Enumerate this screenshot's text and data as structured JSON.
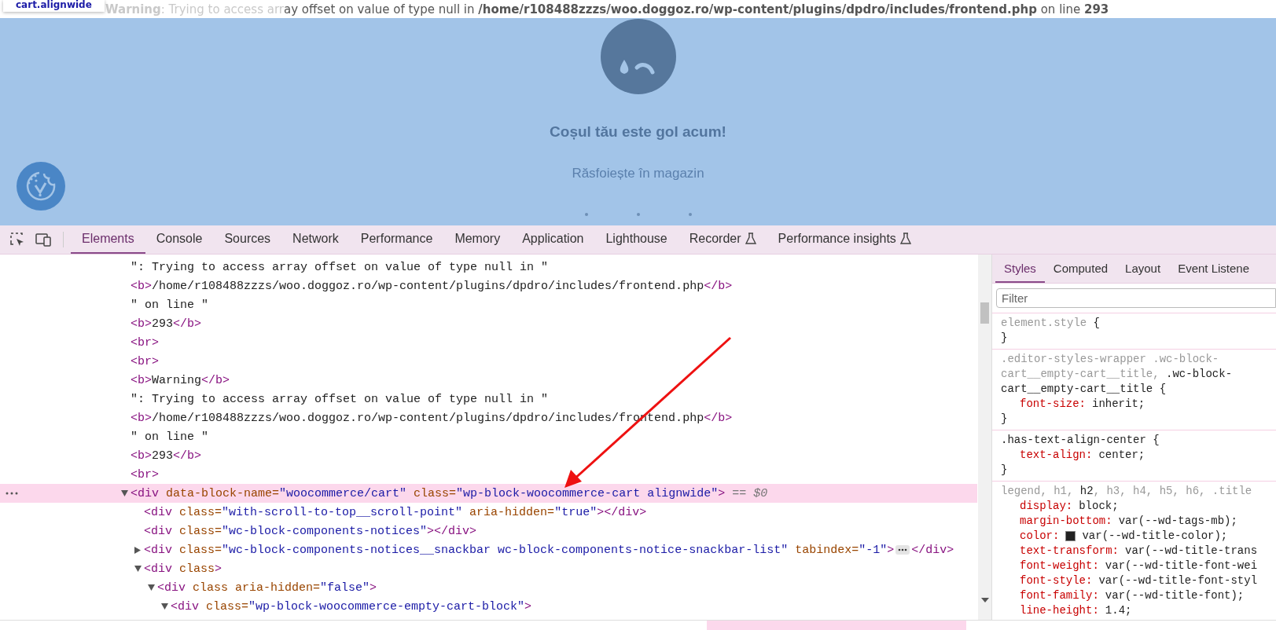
{
  "tooltip": {
    "text": "cart.alignwide"
  },
  "warning": {
    "faded_text": "**Warning**: Trying to access arr",
    "text": "ay offset on value of type null in **/home/r108488zzzs/woo.doggoz.ro/wp-content/plugins/dpdro/includes/frontend.php** on line **293**"
  },
  "preview": {
    "title": "Coșul tău este gol acum!",
    "link": "Răsfoiește în magazin"
  },
  "devtools_tabs": [
    {
      "label": "Elements",
      "selected": true,
      "experimental": false
    },
    {
      "label": "Console",
      "selected": false,
      "experimental": false
    },
    {
      "label": "Sources",
      "selected": false,
      "experimental": false
    },
    {
      "label": "Network",
      "selected": false,
      "experimental": false
    },
    {
      "label": "Performance",
      "selected": false,
      "experimental": false
    },
    {
      "label": "Memory",
      "selected": false,
      "experimental": false
    },
    {
      "label": "Application",
      "selected": false,
      "experimental": false
    },
    {
      "label": "Lighthouse",
      "selected": false,
      "experimental": false
    },
    {
      "label": "Recorder",
      "selected": false,
      "experimental": true
    },
    {
      "label": "Performance insights",
      "selected": false,
      "experimental": true
    }
  ],
  "dom_tree": [
    {
      "selected": false,
      "tokens": [
        {
          "kind": "text",
          "text": "\": Trying to access array offset on value of type null in \""
        }
      ]
    },
    {
      "selected": false,
      "tokens": [
        {
          "kind": "tag",
          "text": "<b>"
        },
        {
          "kind": "text",
          "text": "/home/r108488zzzs/woo.doggoz.ro/wp-content/plugins/dpdro/includes/frontend.php"
        },
        {
          "kind": "tag",
          "text": "</b>"
        }
      ]
    },
    {
      "selected": false,
      "tokens": [
        {
          "kind": "text",
          "text": "\" on line \""
        }
      ]
    },
    {
      "selected": false,
      "tokens": [
        {
          "kind": "tag",
          "text": "<b>"
        },
        {
          "kind": "text",
          "text": "293"
        },
        {
          "kind": "tag",
          "text": "</b>"
        }
      ]
    },
    {
      "selected": false,
      "tokens": [
        {
          "kind": "tag",
          "text": "<br>"
        }
      ]
    },
    {
      "selected": false,
      "tokens": [
        {
          "kind": "tag",
          "text": "<br>"
        }
      ]
    },
    {
      "selected": false,
      "tokens": [
        {
          "kind": "tag",
          "text": "<b>"
        },
        {
          "kind": "text",
          "text": "Warning"
        },
        {
          "kind": "tag",
          "text": "</b>"
        }
      ]
    },
    {
      "selected": false,
      "tokens": [
        {
          "kind": "text",
          "text": "\": Trying to access array offset on value of type null in \""
        }
      ]
    },
    {
      "selected": false,
      "tokens": [
        {
          "kind": "tag",
          "text": "<b>"
        },
        {
          "kind": "text",
          "text": "/home/r108488zzzs/woo.doggoz.ro/wp-content/plugins/dpdro/includes/frontend.php"
        },
        {
          "kind": "tag",
          "text": "</b>"
        }
      ]
    },
    {
      "selected": false,
      "tokens": [
        {
          "kind": "text",
          "text": "\" on line \""
        }
      ]
    },
    {
      "selected": false,
      "tokens": [
        {
          "kind": "tag",
          "text": "<b>"
        },
        {
          "kind": "text",
          "text": "293"
        },
        {
          "kind": "tag",
          "text": "</b>"
        }
      ]
    },
    {
      "selected": false,
      "tokens": [
        {
          "kind": "tag",
          "text": "<br>"
        }
      ]
    },
    {
      "selected": true,
      "expanded": true,
      "tokens": [
        {
          "kind": "tag",
          "text": "<div"
        },
        {
          "kind": "attr",
          "text": " data-block-name="
        },
        {
          "kind": "value",
          "text": "\"woocommerce/cart\""
        },
        {
          "kind": "attr",
          "text": " class="
        },
        {
          "kind": "value",
          "text": "\"wp-block-woocommerce-cart alignwide\""
        },
        {
          "kind": "tag",
          "text": ">"
        },
        {
          "kind": "ref",
          "text": " == $0"
        }
      ],
      "children": [
        {
          "selected": false,
          "tokens": [
            {
              "kind": "tag",
              "text": "<div"
            },
            {
              "kind": "attr",
              "text": " class="
            },
            {
              "kind": "value",
              "text": "\"with-scroll-to-top__scroll-point\""
            },
            {
              "kind": "attr",
              "text": " aria-hidden="
            },
            {
              "kind": "value",
              "text": "\"true\""
            },
            {
              "kind": "tag",
              "text": "></div>"
            }
          ]
        },
        {
          "selected": false,
          "tokens": [
            {
              "kind": "tag",
              "text": "<div"
            },
            {
              "kind": "attr",
              "text": " class="
            },
            {
              "kind": "value",
              "text": "\"wc-block-components-notices\""
            },
            {
              "kind": "tag",
              "text": "></div>"
            }
          ]
        },
        {
          "selected": false,
          "expanded": false,
          "tokens": [
            {
              "kind": "tag",
              "text": "<div"
            },
            {
              "kind": "attr",
              "text": " class="
            },
            {
              "kind": "value",
              "text": "\"wc-block-components-notices__snackbar wc-block-components-notice-snackbar-list\""
            },
            {
              "kind": "attr",
              "text": " tabindex="
            },
            {
              "kind": "value",
              "text": "\"-1\""
            },
            {
              "kind": "tag",
              "text": ">"
            }
          ],
          "closing": [
            {
              "kind": "tag",
              "text": "</div>"
            }
          ]
        },
        {
          "selected": false,
          "expanded": true,
          "tokens": [
            {
              "kind": "tag",
              "text": "<div"
            },
            {
              "kind": "attr",
              "text": " class"
            },
            {
              "kind": "tag",
              "text": ">"
            }
          ],
          "children": [
            {
              "selected": false,
              "expanded": true,
              "tokens": [
                {
                  "kind": "tag",
                  "text": "<div"
                },
                {
                  "kind": "attr",
                  "text": " class aria-hidden="
                },
                {
                  "kind": "value",
                  "text": "\"false\""
                },
                {
                  "kind": "tag",
                  "text": ">"
                }
              ],
              "children": [
                {
                  "selected": false,
                  "expanded": true,
                  "tokens": [
                    {
                      "kind": "tag",
                      "text": "<div"
                    },
                    {
                      "kind": "attr",
                      "text": " class="
                    },
                    {
                      "kind": "value",
                      "text": "\"wp-block-woocommerce-empty-cart-block\""
                    },
                    {
                      "kind": "tag",
                      "text": ">"
                    }
                  ]
                }
              ]
            }
          ]
        }
      ]
    }
  ],
  "styles_tabs": [
    {
      "label": "Styles",
      "selected": true
    },
    {
      "label": "Computed",
      "selected": false
    },
    {
      "label": "Layout",
      "selected": false
    },
    {
      "label": "Event Listene",
      "selected": false
    }
  ],
  "filter": {
    "placeholder": "Filter"
  },
  "rules": [
    {
      "selector": [
        [
          {
            "text": "element.style",
            "matched": false
          },
          {
            "text": " {",
            "matched": true
          }
        ]
      ],
      "close": "}"
    },
    {
      "selector": [
        [
          {
            "text": ".editor-styles-wrapper .wc-block-",
            "matched": false
          }
        ],
        [
          {
            "text": "cart__empty-cart__title,",
            "matched": false
          },
          {
            "text": " .wc-block-",
            "matched": true
          }
        ],
        [
          {
            "text": "cart__empty-cart__title {",
            "matched": true
          }
        ]
      ],
      "declarations": [
        {
          "property": "font-size:",
          "value": "inherit;"
        }
      ],
      "close": "}"
    },
    {
      "selector": [
        [
          {
            "text": ".has-text-align-center {",
            "matched": true
          }
        ]
      ],
      "declarations": [
        {
          "property": "text-align:",
          "value": "center;"
        }
      ],
      "close": "}"
    },
    {
      "selector": [
        [
          {
            "text": "legend, h1, ",
            "matched": false
          },
          {
            "text": "h2",
            "matched": true
          },
          {
            "text": ", h3, h4, h5, h6, .title",
            "matched": false
          }
        ]
      ],
      "declarations": [
        {
          "property": "display:",
          "value": "block;"
        },
        {
          "property": "margin-bottom:",
          "value": "var(--wd-tags-mb);"
        },
        {
          "property": "color:",
          "value": "var(--wd-title-color);",
          "color": "#222222"
        },
        {
          "property": "text-transform:",
          "value": "var(--wd-title-trans"
        },
        {
          "property": "font-weight:",
          "value": "var(--wd-title-font-wei"
        },
        {
          "property": "font-style:",
          "value": "var(--wd-title-font-styl"
        },
        {
          "property": "font-family:",
          "value": "var(--wd-title-font);"
        },
        {
          "property": "line-height:",
          "value": "1.4;"
        }
      ]
    }
  ]
}
